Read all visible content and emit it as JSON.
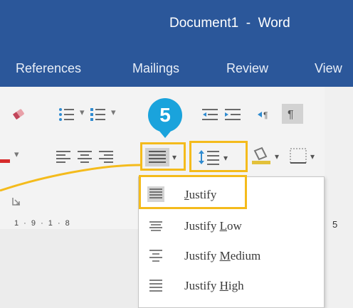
{
  "window": {
    "title": "Document1  -  Word"
  },
  "tabs": [
    "References",
    "Mailings",
    "Review",
    "View"
  ],
  "ruler": {
    "marks": "1 · 9 · 1 · 8",
    "right_mark": "5"
  },
  "callout": {
    "step": "5"
  },
  "colors": {
    "titlebar": "#2b579a",
    "highlight": "#f4bb1c",
    "badge": "#1aa3dc"
  },
  "justify_menu": {
    "items": [
      {
        "label": "Justify",
        "mnemonic": "J",
        "rest": "ustify",
        "selected": true
      },
      {
        "label": "Justify Low",
        "prefix": "Justify ",
        "mnemonic": "L",
        "rest": "ow"
      },
      {
        "label": "Justify Medium",
        "prefix": "Justify ",
        "mnemonic": "M",
        "rest": "edium"
      },
      {
        "label": "Justify High",
        "prefix": "Justify ",
        "mnemonic": "H",
        "rest": "igh"
      }
    ]
  }
}
